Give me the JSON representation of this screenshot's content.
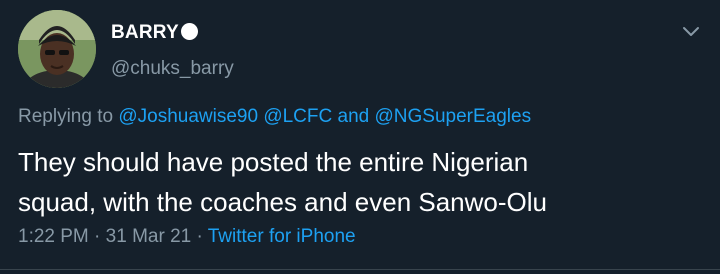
{
  "author": {
    "display_name": "BARRY",
    "handle": "@chuks_barry"
  },
  "reply": {
    "prefix": "Replying to",
    "mention_1": "@Joshuawise90",
    "mention_2": "@LCFC",
    "conjunction": "and",
    "mention_3": "@NGSuperEagles"
  },
  "tweet": {
    "line_1": "They should have posted the entire Nigerian",
    "line_2": "squad, with the coaches and even Sanwo-Olu"
  },
  "meta": {
    "time": "1:22 PM",
    "separator": "·",
    "date": "31 Mar 21",
    "source": "Twitter for iPhone"
  },
  "colors": {
    "background": "#15202b",
    "text": "#ffffff",
    "muted": "#8899a6",
    "link": "#1da1f2",
    "divider": "#38444d"
  },
  "icons": {
    "more_menu": "chevron-down-icon",
    "status": "white-circle-emoji"
  }
}
